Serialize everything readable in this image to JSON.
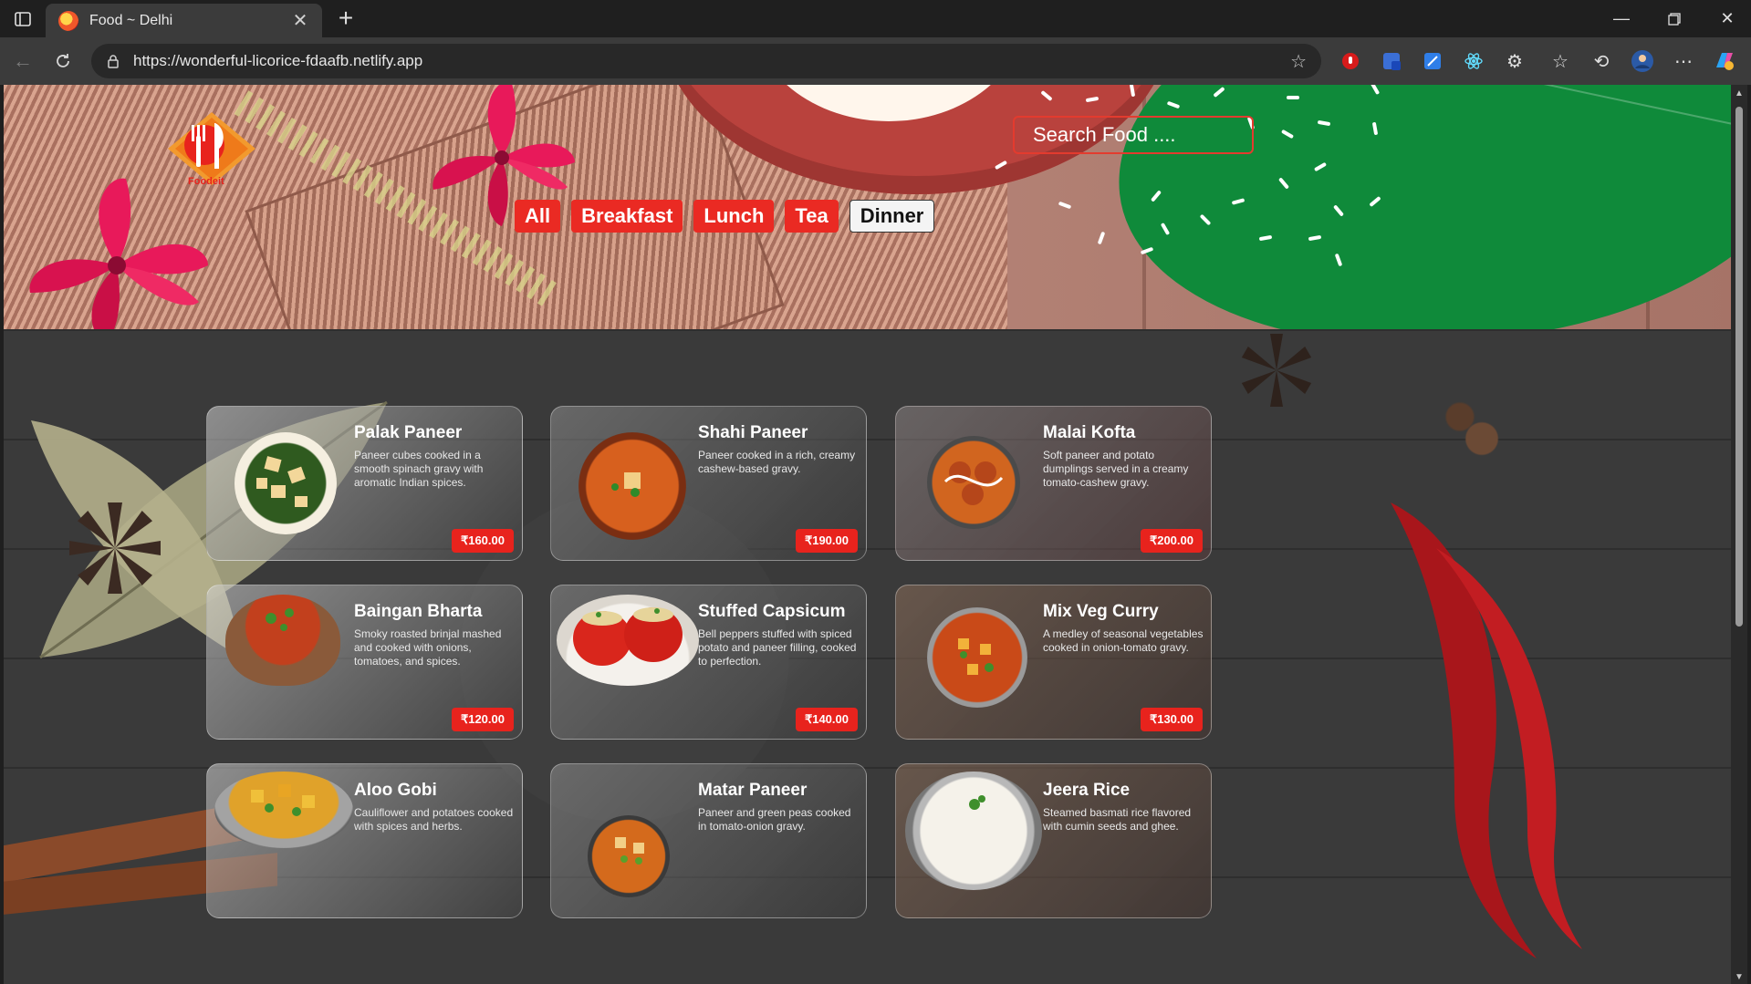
{
  "browser": {
    "tab_title": "Food ~ Delhi",
    "url": "https://wonderful-licorice-fdaafb.netlify.app"
  },
  "header": {
    "logo_text": "Foodeit",
    "search_placeholder": "Search Food ....",
    "filters": [
      {
        "label": "All",
        "active": false
      },
      {
        "label": "Breakfast",
        "active": false
      },
      {
        "label": "Lunch",
        "active": false
      },
      {
        "label": "Tea",
        "active": false
      },
      {
        "label": "Dinner",
        "active": true
      }
    ]
  },
  "menu": {
    "items": [
      {
        "name": "Palak Paneer",
        "description": "Paneer cubes cooked in a smooth spinach gravy with aromatic Indian spices.",
        "price": "₹160.00"
      },
      {
        "name": "Shahi Paneer",
        "description": "Paneer cooked in a rich, creamy cashew-based gravy.",
        "price": "₹190.00"
      },
      {
        "name": "Malai Kofta",
        "description": "Soft paneer and potato dumplings served in a creamy tomato-cashew gravy.",
        "price": "₹200.00"
      },
      {
        "name": "Baingan Bharta",
        "description": "Smoky roasted brinjal mashed and cooked with onions, tomatoes, and spices.",
        "price": "₹120.00"
      },
      {
        "name": "Stuffed Capsicum",
        "description": "Bell peppers stuffed with spiced potato and paneer filling, cooked to perfection.",
        "price": "₹140.00"
      },
      {
        "name": "Mix Veg Curry",
        "description": "A medley of seasonal vegetables cooked in onion-tomato gravy.",
        "price": "₹130.00"
      },
      {
        "name": "Aloo Gobi",
        "description": "Cauliflower and potatoes cooked with spices and herbs.",
        "price": ""
      },
      {
        "name": "Matar Paneer",
        "description": "Paneer and green peas cooked in tomato-onion gravy.",
        "price": ""
      },
      {
        "name": "Jeera Rice",
        "description": "Steamed basmati rice flavored with cumin seeds and ghee.",
        "price": ""
      }
    ]
  },
  "colors": {
    "accent_red": "#ea2a23",
    "browser_dark": "#1f1f1f"
  }
}
